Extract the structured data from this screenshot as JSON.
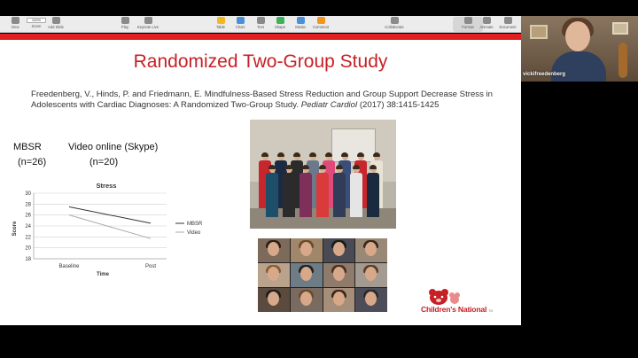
{
  "toolbar": {
    "items": [
      {
        "label": "View",
        "icon": "view-icon"
      },
      {
        "label": "Zoom",
        "value": "100%",
        "icon": "zoom-select"
      },
      {
        "label": "Add Slide",
        "icon": "add-slide-icon"
      },
      {
        "label": "Play",
        "icon": "play-icon"
      },
      {
        "label": "Keynote Live",
        "icon": "keynote-live-icon"
      },
      {
        "label": "Table",
        "icon": "table-icon"
      },
      {
        "label": "Chart",
        "icon": "chart-icon"
      },
      {
        "label": "Text",
        "icon": "text-icon"
      },
      {
        "label": "Shape",
        "icon": "shape-icon"
      },
      {
        "label": "Media",
        "icon": "media-icon"
      },
      {
        "label": "Comment",
        "icon": "comment-icon"
      },
      {
        "label": "Collaborate",
        "icon": "collaborate-icon"
      },
      {
        "label": "Format",
        "icon": "format-icon"
      },
      {
        "label": "Animate",
        "icon": "animate-icon"
      },
      {
        "label": "Document",
        "icon": "document-icon"
      }
    ]
  },
  "slide": {
    "title": "Randomized Two-Group Study",
    "citation_main": "Freedenberg, V., Hinds, P. and Friedmann, E. Mindfulness-Based Stress Reduction and Group Support Decrease Stress in Adolescents with Cardiac Diagnoses: A Randomized Two-Group Study.",
    "citation_journal": "Pediatr Cardiol",
    "citation_tail": "(2017) 38:1415-1425",
    "group1_name": "MBSR",
    "group1_n": "(n=26)",
    "group2_name": "Video online (Skype)",
    "group2_n": "(n=20)",
    "logo_text": "Children's National",
    "logo_tm": "TM"
  },
  "chart_data": {
    "type": "line",
    "title": "Stress",
    "xlabel": "Time",
    "ylabel": "Score",
    "categories": [
      "Baseline",
      "Post"
    ],
    "ylim": [
      18,
      30
    ],
    "yticks": [
      18,
      20,
      22,
      24,
      26,
      28,
      30
    ],
    "grid": true,
    "legend_position": "right",
    "series": [
      {
        "name": "MBSR",
        "values": [
          27.5,
          24.5
        ],
        "color": "#333333"
      },
      {
        "name": "Video",
        "values": [
          26.0,
          21.7
        ],
        "color": "#aaaaaa"
      }
    ]
  },
  "webcam": {
    "participant_name": "vickifreedenberg"
  },
  "colors": {
    "accent": "#c62026",
    "bar": "#e02020"
  }
}
